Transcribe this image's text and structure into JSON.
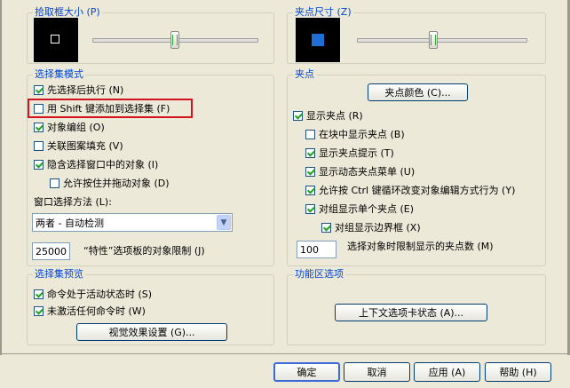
{
  "pickbox": {
    "title": "拾取框大小 (P)",
    "slider_level": 0.5
  },
  "grip_size": {
    "title": "夹点尺寸 (Z)",
    "slider_level": 0.45
  },
  "selection_modes": {
    "title": "选择集模式",
    "items": [
      {
        "label": "先选择后执行 (N)",
        "checked": true
      },
      {
        "label": "用 Shift 键添加到选择集 (F)",
        "checked": false
      },
      {
        "label": "对象编组 (O)",
        "checked": true
      },
      {
        "label": "关联图案填充 (V)",
        "checked": false
      },
      {
        "label": "隐含选择窗口中的对象 (I)",
        "checked": true
      },
      {
        "label": "允许按住并拖动对象 (D)",
        "checked": false
      }
    ],
    "window_method_label": "窗口选择方法 (L):",
    "window_method_value": "两者 - 自动检测",
    "limit_value": "25000",
    "limit_label": "“特性”选项板的对象限制 (J)"
  },
  "grips": {
    "title": "夹点",
    "color_button": "夹点颜色 (C)...",
    "items": [
      {
        "label": "显示夹点 (R)",
        "checked": true
      },
      {
        "label": "在块中显示夹点 (B)",
        "checked": false
      },
      {
        "label": "显示夹点提示 (T)",
        "checked": true
      },
      {
        "label": "显示动态夹点菜单 (U)",
        "checked": true
      },
      {
        "label": "允许按 Ctrl 键循环改变对象编辑方式行为 (Y)",
        "checked": true
      },
      {
        "label": "对组显示单个夹点 (E)",
        "checked": true
      },
      {
        "label": "对组显示边界框 (X)",
        "checked": true
      }
    ],
    "limit_value": "100",
    "limit_label": "选择对象时限制显示的夹点数 (M)"
  },
  "preview": {
    "title": "选择集预览",
    "items": [
      {
        "label": "命令处于活动状态时 (S)",
        "checked": true
      },
      {
        "label": "未激活任何命令时 (W)",
        "checked": true
      }
    ],
    "effects_button": "视觉效果设置 (G)..."
  },
  "ribbon": {
    "title": "功能区选项",
    "context_button": "上下文选项卡状态 (A)..."
  },
  "footer": {
    "ok": "确定",
    "cancel": "取消",
    "apply": "应用 (A)",
    "help": "帮助 (H)"
  },
  "colors": {
    "group_title": "#0046d5",
    "highlight": "#d4121b",
    "grip_preview": "#1f6fd6"
  }
}
